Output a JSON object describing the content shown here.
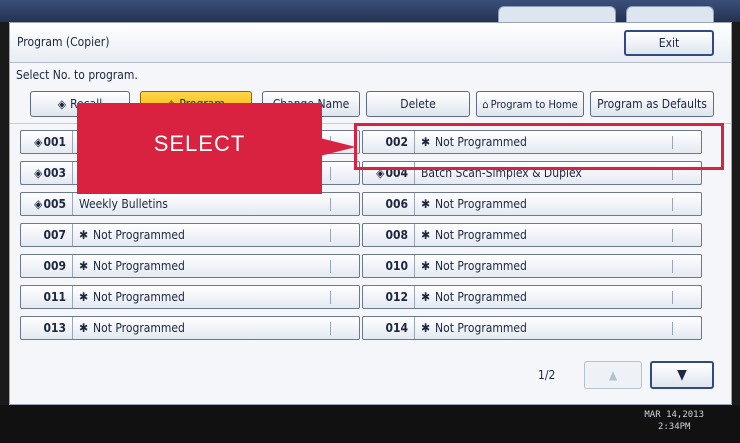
{
  "window": {
    "title": "Program (Copier)",
    "exit_label": "Exit"
  },
  "instruction": "Select No. to program.",
  "toolbar": {
    "recall": "Recall",
    "program": "Program",
    "change_name": "Change Name",
    "delete": "Delete",
    "program_to_home": "Program to Home",
    "program_as_defaults": "Program as Defaults"
  },
  "programs_left": [
    {
      "num": "001",
      "marked": true,
      "name": "",
      "star": false
    },
    {
      "num": "003",
      "marked": true,
      "name": "",
      "star": false
    },
    {
      "num": "005",
      "marked": true,
      "name": "Weekly Bulletins",
      "star": false
    },
    {
      "num": "007",
      "marked": false,
      "name": "Not Programmed",
      "star": true
    },
    {
      "num": "009",
      "marked": false,
      "name": "Not Programmed",
      "star": true
    },
    {
      "num": "011",
      "marked": false,
      "name": "Not Programmed",
      "star": true
    },
    {
      "num": "013",
      "marked": false,
      "name": "Not Programmed",
      "star": true
    }
  ],
  "programs_right": [
    {
      "num": "002",
      "marked": false,
      "name": "Not Programmed",
      "star": true
    },
    {
      "num": "004",
      "marked": true,
      "name": "Batch Scan-Simplex & Duplex",
      "star": false
    },
    {
      "num": "006",
      "marked": false,
      "name": "Not Programmed",
      "star": true
    },
    {
      "num": "008",
      "marked": false,
      "name": "Not Programmed",
      "star": true
    },
    {
      "num": "010",
      "marked": false,
      "name": "Not Programmed",
      "star": true
    },
    {
      "num": "012",
      "marked": false,
      "name": "Not Programmed",
      "star": true
    },
    {
      "num": "014",
      "marked": false,
      "name": "Not Programmed",
      "star": true
    }
  ],
  "pager": {
    "page": "1/2"
  },
  "callout": {
    "text": "SELECT"
  },
  "status": {
    "date": "MAR  14,2013",
    "time": "2:34PM"
  },
  "colors": {
    "accent_red": "#d8223f",
    "active_yellow": "#f2b600"
  }
}
